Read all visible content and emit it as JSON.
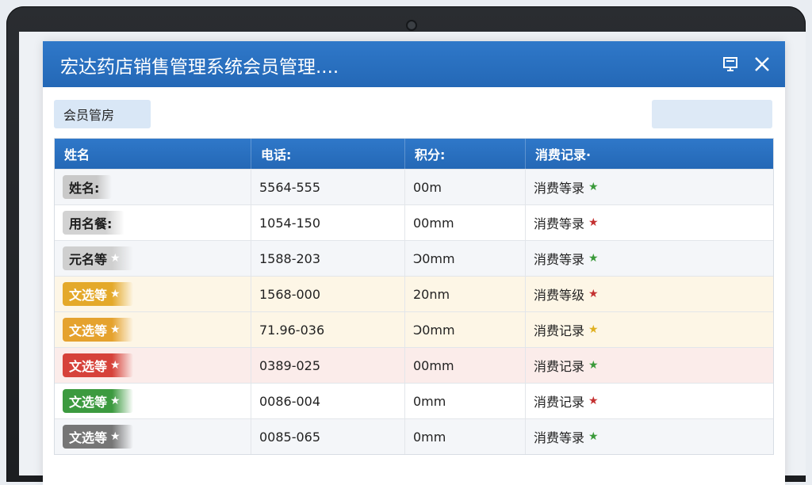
{
  "window": {
    "title": "宏达药店销售管理系统会员管理....",
    "restore_icon": "restore-window-icon",
    "close_icon": "close-icon"
  },
  "toolbar": {
    "section_label": "会员管房",
    "search_value": ""
  },
  "table": {
    "headers": [
      "姓名",
      "电话:",
      "积分:",
      "消费记录·"
    ],
    "rows": [
      {
        "name": "姓名:",
        "tag_color": "#c9c9c9",
        "tag_text_color": "#1d1d1d",
        "tag_star": "",
        "phone": "5564-555",
        "points": "00m",
        "record": "消费等录",
        "record_star": "★",
        "record_star_color": "#3a9a3a",
        "row_bg": "#f4f6f9"
      },
      {
        "name": "用名餐:",
        "tag_color": "#d2d2d2",
        "tag_text_color": "#1d1d1d",
        "tag_star": "",
        "phone": "1054-150",
        "points": "00mm",
        "record": "消费等录",
        "record_star": "★",
        "record_star_color": "#c43030",
        "row_bg": "#ffffff"
      },
      {
        "name": "元名等",
        "tag_color": "#cfcfcf",
        "tag_text_color": "#1d1d1d",
        "tag_star": "★",
        "phone": "1588-203",
        "points": "Ͻ0mm",
        "record": "消费等录",
        "record_star": "★",
        "record_star_color": "#3a9a3a",
        "row_bg": "#f4f6f9"
      },
      {
        "name": "文选等",
        "tag_color": "#e4a92a",
        "tag_text_color": "#ffffff",
        "tag_star": "★",
        "phone": "1568-000",
        "points": "20nm",
        "record": "消费等级",
        "record_star": "★",
        "record_star_color": "#c43030",
        "row_bg": "#fdf6e6"
      },
      {
        "name": "文选等",
        "tag_color": "#e5a22e",
        "tag_text_color": "#ffffff",
        "tag_star": "★",
        "phone": "71.96-036",
        "points": "Ͻ0mm",
        "record": "消费记录",
        "record_star": "★",
        "record_star_color": "#e0b020",
        "row_bg": "#fdf6e6"
      },
      {
        "name": "文选等",
        "tag_color": "#d6423a",
        "tag_text_color": "#ffffff",
        "tag_star": "★",
        "phone": "0389-025",
        "points": "00mm",
        "record": "消费记录",
        "record_star": "★",
        "record_star_color": "#3a9a3a",
        "row_bg": "#fbecea"
      },
      {
        "name": "文选等",
        "tag_color": "#3c9a3f",
        "tag_text_color": "#ffffff",
        "tag_star": "★",
        "phone": "0086-004",
        "points": "0mm",
        "record": "消费记录",
        "record_star": "★",
        "record_star_color": "#c43030",
        "row_bg": "#ffffff"
      },
      {
        "name": "文选等",
        "tag_color": "#767676",
        "tag_text_color": "#ffffff",
        "tag_star": "★",
        "phone": "0085-065",
        "points": "0mm",
        "record": "消费等录",
        "record_star": "★",
        "record_star_color": "#3a9a3a",
        "row_bg": "#f4f6f9"
      }
    ]
  }
}
